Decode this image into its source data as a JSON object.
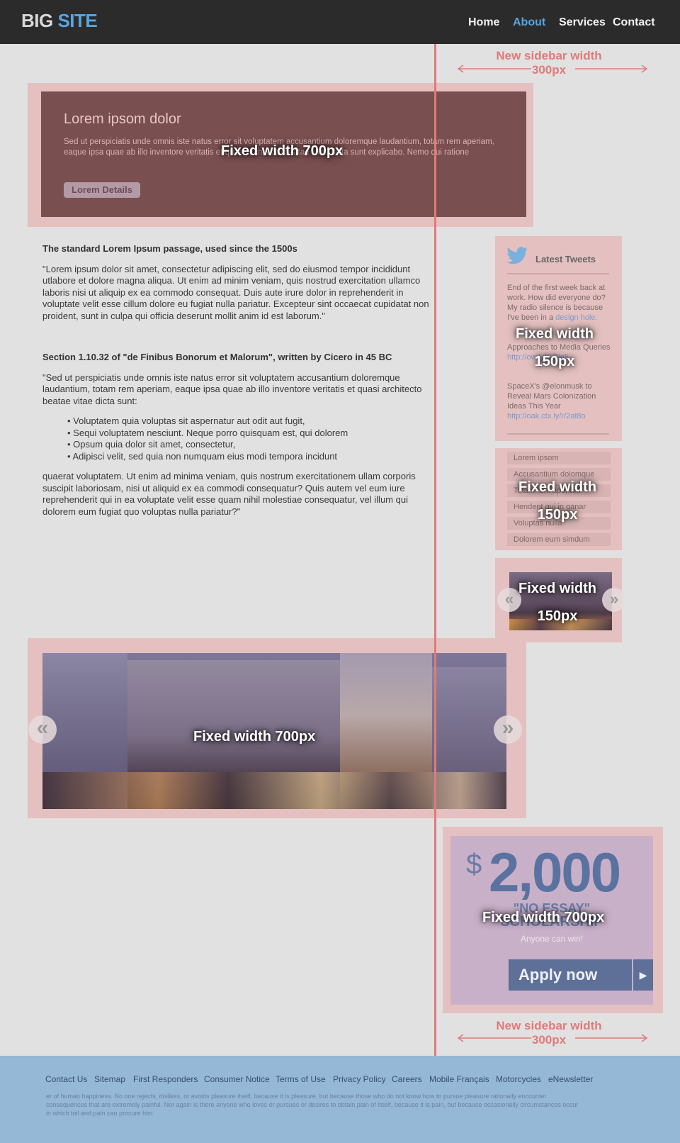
{
  "header": {
    "logo_part1": "BIG",
    "logo_part2": "SITE",
    "nav": [
      "Home",
      "About",
      "Services",
      "Contact"
    ],
    "active_nav": "About"
  },
  "notes": {
    "sidebar_top_line1": "New sidebar width",
    "sidebar_top_line2": "300px",
    "sidebar_bottom_line1": "New sidebar width",
    "sidebar_bottom_line2": "300px",
    "hero_label": "Fixed width 700px",
    "tweets_label_line1": "Fixed width",
    "tweets_label_line2": "150px",
    "cats_label_line1": "Fixed width",
    "cats_label_line2": "150px",
    "thumb_label_line1": "Fixed width",
    "thumb_label_line2": "150px",
    "slider_label": "Fixed width 700px",
    "ad_label": "Fixed width 700px"
  },
  "hero": {
    "title": "Lorem ipsom dolor",
    "body": "Sed ut perspiciatis unde omnis iste natus error sit voluptatem accusantium doloremque laudantium, totam rem aperiam, eaque ipsa quae ab illo inventore veritatis et quasi architecto beatae vitae dicta sunt explicabo. Nemo qui ratione",
    "button": "Lorem Details"
  },
  "article": {
    "h1": "The standard Lorem Ipsum passage, used since the 1500s",
    "p1": "\"Lorem ipsum dolor sit amet, consectetur adipiscing elit, sed do eiusmod tempor incididunt utlabore et dolore magna aliqua. Ut enim ad minim veniam, quis nostrud exercitation ullamco laboris nisi ut aliquip ex ea commodo consequat. Duis aute irure dolor in reprehenderit in voluptate velit esse cillum dolore eu fugiat nulla pariatur. Excepteur sint occaecat cupidatat non proident, sunt in culpa qui officia deserunt mollit anim id est laborum.\"",
    "h2": "Section 1.10.32 of \"de Finibus Bonorum et Malorum\", written by Cicero in 45 BC",
    "p2": "\"Sed ut perspiciatis unde omnis iste natus error sit voluptatem accusantium doloremque laudantium, totam rem aperiam, eaque ipsa quae ab illo inventore veritatis et quasi architecto beatae vitae dicta sunt:",
    "bullets": [
      "Voluptatem quia voluptas sit aspernatur aut odit aut fugit,",
      "Sequi voluptatem nesciunt. Neque porro quisquam est, qui dolorem",
      "Opsum quia dolor sit amet, consectetur,",
      "Adipisci velit, sed quia non numquam eius modi tempora incidunt"
    ],
    "p3": "quaerat voluptatem. Ut enim ad minima veniam, quis nostrum exercitationem ullam corporis suscipit laboriosam, nisi ut aliquid ex ea commodi consequatur? Quis autem vel eum iure reprehenderit qui in ea voluptate velit esse quam nihil molestiae consequatur, vel illum qui dolorem eum fugiat quo voluptas nulla pariatur?\""
  },
  "tweets": {
    "title": "Latest Tweets",
    "t1": "End of the first week back at work. How did everyone do? My radio silence is because I've been in a",
    "t1_link": "design hole.",
    "t2": "Approaches to Media Queries",
    "t2_link": "http://ow.ly/GOie5",
    "t3": "SpaceX's @elonmusk to Reveal Mars Colonization Ideas This Year",
    "t3_link": "http://oak.ctx.ly/r/2at8o"
  },
  "categories": [
    "Lorem ipsom",
    "Accusantium dolomque",
    "Totam rem aperiam",
    "Hendent qui in ganar",
    "Voluptas nulla",
    "Dolorem eum simdum"
  ],
  "slider": {
    "prev": "«",
    "next": "»"
  },
  "ad": {
    "currency": "$",
    "amount": "2,000",
    "line1": "\"NO ESSAY\"",
    "line2": "SCHOLARSHIP",
    "sub": "Anyone can win!",
    "cta": "Apply now",
    "cta_arrow": "▶"
  },
  "footer": {
    "links": [
      "Contact Us",
      "Sitemap",
      "First Responders",
      "Consumer Notice",
      "Terms of Use",
      "Privacy Policy",
      "Careers",
      "Mobile Français",
      "Motorcycles",
      "eNewsletter"
    ],
    "fine": "er of human happiness. No one rejects, dislikes, or avoids pleasure itself, because it is pleasure, but because those who do not know how to pursue pleasure rationally encounter consequences that are extremely painful. Nor again is there anyone who loves or pursues or desires to obtain pain of itself, because it is pain, but because occasionally circumstances occur in which toil and pain can procure him"
  },
  "colors": {
    "header_bg": "#2b2b2b",
    "accent": "#5aa5e0",
    "overlay_pink": "#e4c0c0",
    "guide_red": "#e07a7a",
    "footer_bg": "#95b8d6"
  }
}
